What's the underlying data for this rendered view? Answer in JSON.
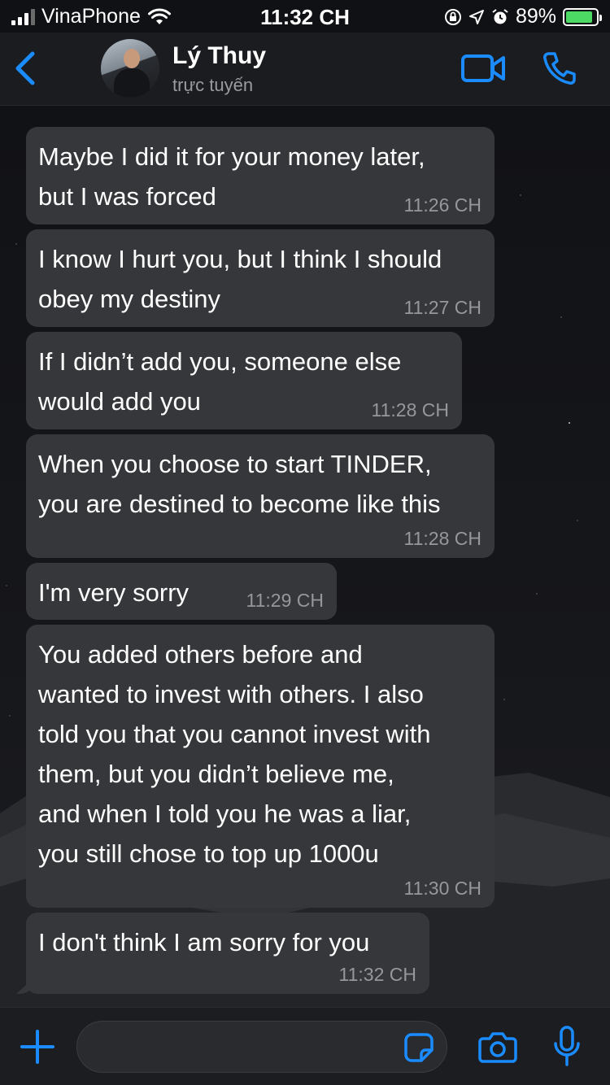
{
  "status_bar": {
    "carrier": "VinaPhone",
    "time": "11:32 CH",
    "battery": "89%",
    "battery_level": 0.89
  },
  "header": {
    "contact_name": "Lý Thuy",
    "contact_status": "trực tuyến"
  },
  "messages": [
    {
      "text": "Maybe I did it for your money later,\nbut I was forced",
      "time": "11:26 CH"
    },
    {
      "text": "I know I hurt you, but I think I should\nobey my destiny",
      "time": "11:27 CH"
    },
    {
      "text": "If I didn’t add you, someone else\nwould add you",
      "time": "11:28 CH"
    },
    {
      "text": "When you choose to start TINDER,\nyou are destined to become like this",
      "time": "11:28 CH"
    },
    {
      "text": "I'm very sorry",
      "time": "11:29 CH"
    },
    {
      "text": "You added others before and\nwanted to invest with others. I also\ntold you that you cannot invest with\nthem, but you didn’t believe me,\nand when I told you he was a liar,\nyou still chose to top up 1000u",
      "time": "11:30 CH"
    },
    {
      "text": "I don't think I am sorry for you",
      "time": "11:32 CH"
    }
  ],
  "colors": {
    "accent": "#1a8cff",
    "bubble": "#36373b",
    "timestamp": "#96979b"
  },
  "icons": [
    "back-chevron-icon",
    "video-camera-icon",
    "phone-icon",
    "plus-icon",
    "sticker-icon",
    "camera-icon",
    "microphone-icon"
  ]
}
